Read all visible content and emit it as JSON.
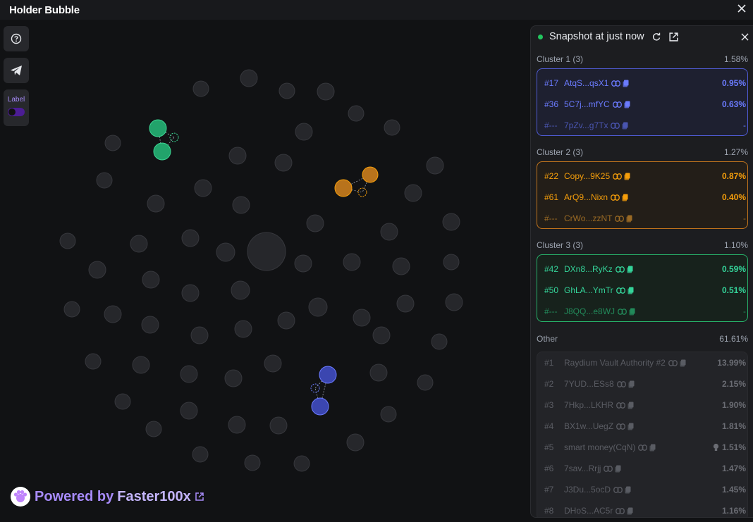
{
  "window": {
    "title": "Holder Bubble"
  },
  "toolbar": {
    "label_toggle": "Label",
    "label_on": true
  },
  "powered": {
    "text": "Powered by",
    "brand": "Faster100x"
  },
  "panel": {
    "title": "Snapshot at just now",
    "clusters": [
      {
        "name": "Cluster 1 (3)",
        "total": "1.58%",
        "color": "#6b7bff",
        "rows": [
          {
            "rank": "#17",
            "addr": "AtqS...qsX1",
            "pct": "0.95%"
          },
          {
            "rank": "#36",
            "addr": "5C7j...mfYC",
            "pct": "0.63%"
          },
          {
            "rank": "#---",
            "addr": "7pZv...g7Tx",
            "pct": "-"
          }
        ]
      },
      {
        "name": "Cluster 2 (3)",
        "total": "1.27%",
        "color": "#f59e0b",
        "rows": [
          {
            "rank": "#22",
            "addr": "Copy...9K25",
            "pct": "0.87%"
          },
          {
            "rank": "#61",
            "addr": "ArQ9...Nixn",
            "pct": "0.40%"
          },
          {
            "rank": "#---",
            "addr": "CrWo...zzNT",
            "pct": "-"
          }
        ]
      },
      {
        "name": "Cluster 3 (3)",
        "total": "1.10%",
        "color": "#34d399",
        "rows": [
          {
            "rank": "#42",
            "addr": "DXn8...RyKz",
            "pct": "0.59%"
          },
          {
            "rank": "#50",
            "addr": "GhLA...YmTr",
            "pct": "0.51%"
          },
          {
            "rank": "#---",
            "addr": "J8QQ...e8WJ",
            "pct": "-"
          }
        ]
      }
    ],
    "other": {
      "name": "Other",
      "total": "61.61%",
      "rows": [
        {
          "rank": "#1",
          "addr": "Raydium Vault Authority #2",
          "pct": "13.99%"
        },
        {
          "rank": "#2",
          "addr": "7YUD...ESs8",
          "pct": "2.15%"
        },
        {
          "rank": "#3",
          "addr": "7Hkp...LKHR",
          "pct": "1.90%"
        },
        {
          "rank": "#4",
          "addr": "BX1w...UegZ",
          "pct": "1.81%"
        },
        {
          "rank": "#5",
          "addr": "smart money(CqN)",
          "pct": "1.51%",
          "badge": "bulb-icon"
        },
        {
          "rank": "#6",
          "addr": "7sav...Rrjj",
          "pct": "1.47%"
        },
        {
          "rank": "#7",
          "addr": "J3Du...5ocD",
          "pct": "1.45%"
        },
        {
          "rank": "#8",
          "addr": "DHoS...AC5r",
          "pct": "1.16%"
        }
      ]
    }
  }
}
